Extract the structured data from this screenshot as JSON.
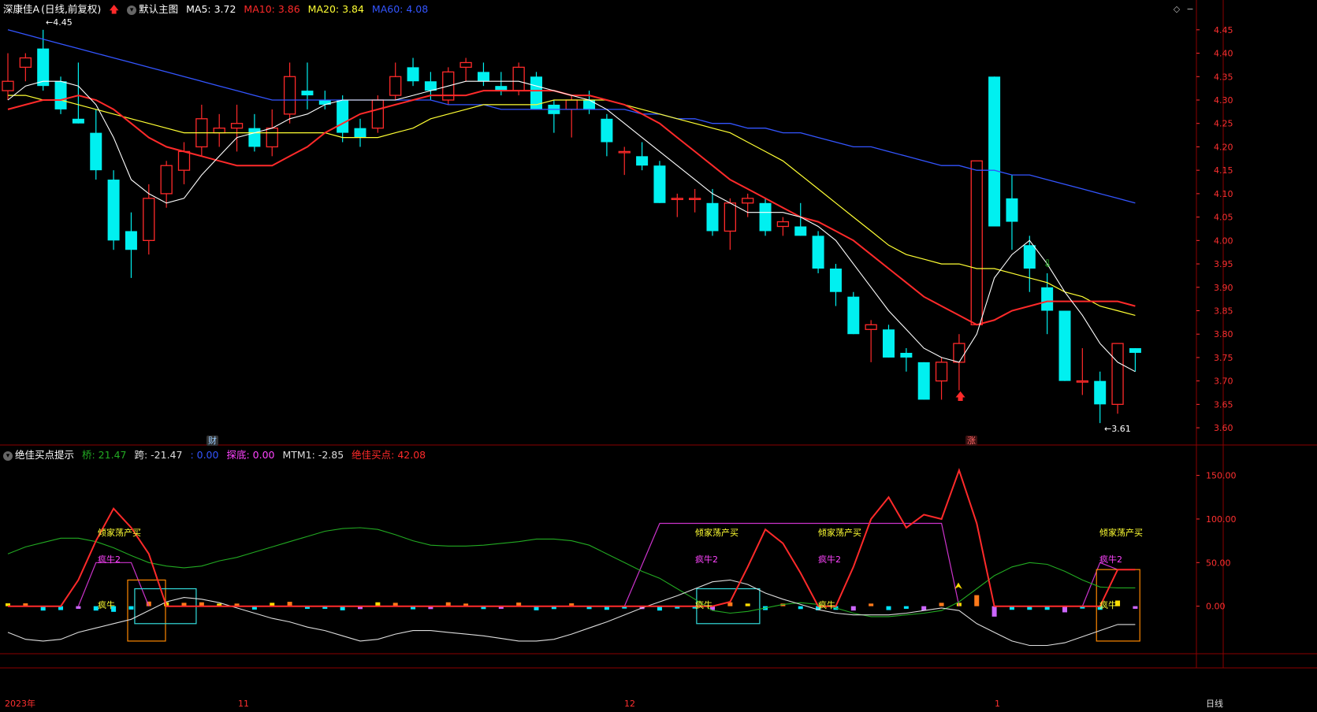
{
  "header": {
    "stock_name": "深康佳A",
    "period": "(日线,前复权)",
    "main_chart_label": "默认主图",
    "ma": [
      {
        "label": "MA5: 3.72",
        "color": "#ffffff"
      },
      {
        "label": "MA10: 3.86",
        "color": "#ff2a2a"
      },
      {
        "label": "MA20: 3.84",
        "color": "#ffff33"
      },
      {
        "label": "MA60: 4.08",
        "color": "#3355ff"
      }
    ],
    "icon_up_arrow": "red-up-arrow-icon",
    "icon_dropdown": "circle-dropdown-icon",
    "ctrl_diamond": "◇",
    "ctrl_minus": "−"
  },
  "indicator_header": {
    "name": "绝佳买点提示",
    "items": [
      {
        "label": "桥: 21.47",
        "color": "#22aa22"
      },
      {
        "label": "跨: -21.47",
        "color": "#dddddd"
      },
      {
        "label": ": 0.00",
        "color": "#3355ff"
      },
      {
        "label": "探底: 0.00",
        "color": "#ff44ff"
      },
      {
        "label": "MTM1: -2.85",
        "color": "#dddddd"
      },
      {
        "label": "绝佳买点: 42.08",
        "color": "#ff2a2a"
      }
    ]
  },
  "annotations": {
    "high_label": "4.45",
    "low_label": "3.61",
    "cai_badge": "财",
    "zhang_badge": "涨",
    "qingjia": "倾家荡产买",
    "fengniu2": "疯牛2",
    "fengniu": "疯牛"
  },
  "x_axis": {
    "labels": [
      "2023年",
      "11",
      "12",
      "1"
    ],
    "right_label": "日线"
  },
  "colors": {
    "up": "#ff2a2a",
    "down": "#00f0f0",
    "ma5": "#ffffff",
    "ma10": "#ff2a2a",
    "ma20": "#ffff33",
    "ma60": "#3355ff",
    "grid": "#8b0000",
    "axis_text": "#ff3030"
  },
  "chart_data": [
    {
      "type": "candlestick",
      "title": "深康佳A (日线,前复权)",
      "y_ticks": [
        4.45,
        4.4,
        4.35,
        4.3,
        4.25,
        4.2,
        4.15,
        4.1,
        4.05,
        4.0,
        3.95,
        3.9,
        3.85,
        3.8,
        3.75,
        3.7,
        3.65,
        3.6
      ],
      "ylim": [
        3.58,
        4.48
      ],
      "candles": [
        {
          "o": 4.32,
          "h": 4.4,
          "l": 4.3,
          "c": 4.34
        },
        {
          "o": 4.37,
          "h": 4.4,
          "l": 4.34,
          "c": 4.39
        },
        {
          "o": 4.41,
          "h": 4.45,
          "l": 4.32,
          "c": 4.33
        },
        {
          "o": 4.34,
          "h": 4.35,
          "l": 4.27,
          "c": 4.28
        },
        {
          "o": 4.26,
          "h": 4.38,
          "l": 4.25,
          "c": 4.25
        },
        {
          "o": 4.23,
          "h": 4.28,
          "l": 4.13,
          "c": 4.15
        },
        {
          "o": 4.13,
          "h": 4.15,
          "l": 3.98,
          "c": 4.0
        },
        {
          "o": 4.02,
          "h": 4.06,
          "l": 3.92,
          "c": 3.98
        },
        {
          "o": 4.0,
          "h": 4.12,
          "l": 3.97,
          "c": 4.09
        },
        {
          "o": 4.1,
          "h": 4.17,
          "l": 4.07,
          "c": 4.16
        },
        {
          "o": 4.15,
          "h": 4.21,
          "l": 4.12,
          "c": 4.19
        },
        {
          "o": 4.2,
          "h": 4.29,
          "l": 4.18,
          "c": 4.26
        },
        {
          "o": 4.23,
          "h": 4.27,
          "l": 4.2,
          "c": 4.24
        },
        {
          "o": 4.24,
          "h": 4.29,
          "l": 4.19,
          "c": 4.25
        },
        {
          "o": 4.24,
          "h": 4.27,
          "l": 4.19,
          "c": 4.2
        },
        {
          "o": 4.2,
          "h": 4.28,
          "l": 4.18,
          "c": 4.24
        },
        {
          "o": 4.27,
          "h": 4.38,
          "l": 4.25,
          "c": 4.35
        },
        {
          "o": 4.32,
          "h": 4.38,
          "l": 4.28,
          "c": 4.31
        },
        {
          "o": 4.3,
          "h": 4.32,
          "l": 4.28,
          "c": 4.29
        },
        {
          "o": 4.3,
          "h": 4.31,
          "l": 4.21,
          "c": 4.23
        },
        {
          "o": 4.24,
          "h": 4.26,
          "l": 4.2,
          "c": 4.22
        },
        {
          "o": 4.24,
          "h": 4.31,
          "l": 4.23,
          "c": 4.3
        },
        {
          "o": 4.31,
          "h": 4.38,
          "l": 4.3,
          "c": 4.35
        },
        {
          "o": 4.37,
          "h": 4.39,
          "l": 4.33,
          "c": 4.34
        },
        {
          "o": 4.34,
          "h": 4.36,
          "l": 4.3,
          "c": 4.32
        },
        {
          "o": 4.3,
          "h": 4.37,
          "l": 4.29,
          "c": 4.36
        },
        {
          "o": 4.37,
          "h": 4.39,
          "l": 4.34,
          "c": 4.38
        },
        {
          "o": 4.36,
          "h": 4.38,
          "l": 4.33,
          "c": 4.34
        },
        {
          "o": 4.33,
          "h": 4.36,
          "l": 4.31,
          "c": 4.32
        },
        {
          "o": 4.32,
          "h": 4.38,
          "l": 4.31,
          "c": 4.37
        },
        {
          "o": 4.35,
          "h": 4.36,
          "l": 4.28,
          "c": 4.28
        },
        {
          "o": 4.29,
          "h": 4.3,
          "l": 4.23,
          "c": 4.27
        },
        {
          "o": 4.28,
          "h": 4.31,
          "l": 4.22,
          "c": 4.3
        },
        {
          "o": 4.3,
          "h": 4.32,
          "l": 4.27,
          "c": 4.28
        },
        {
          "o": 4.26,
          "h": 4.27,
          "l": 4.18,
          "c": 4.21
        },
        {
          "o": 4.19,
          "h": 4.2,
          "l": 4.14,
          "c": 4.19
        },
        {
          "o": 4.18,
          "h": 4.21,
          "l": 4.15,
          "c": 4.16
        },
        {
          "o": 4.16,
          "h": 4.17,
          "l": 4.08,
          "c": 4.08
        },
        {
          "o": 4.09,
          "h": 4.1,
          "l": 4.05,
          "c": 4.09
        },
        {
          "o": 4.09,
          "h": 4.11,
          "l": 4.06,
          "c": 4.09
        },
        {
          "o": 4.08,
          "h": 4.11,
          "l": 4.01,
          "c": 4.02
        },
        {
          "o": 4.02,
          "h": 4.09,
          "l": 3.98,
          "c": 4.08
        },
        {
          "o": 4.08,
          "h": 4.1,
          "l": 4.05,
          "c": 4.09
        },
        {
          "o": 4.08,
          "h": 4.09,
          "l": 4.01,
          "c": 4.02
        },
        {
          "o": 4.03,
          "h": 4.05,
          "l": 4.01,
          "c": 4.04
        },
        {
          "o": 4.03,
          "h": 4.08,
          "l": 4.01,
          "c": 4.01
        },
        {
          "o": 4.01,
          "h": 4.02,
          "l": 3.93,
          "c": 3.94
        },
        {
          "o": 3.94,
          "h": 3.95,
          "l": 3.86,
          "c": 3.89
        },
        {
          "o": 3.88,
          "h": 3.89,
          "l": 3.8,
          "c": 3.8
        },
        {
          "o": 3.81,
          "h": 3.83,
          "l": 3.74,
          "c": 3.82
        },
        {
          "o": 3.81,
          "h": 3.82,
          "l": 3.75,
          "c": 3.75
        },
        {
          "o": 3.76,
          "h": 3.77,
          "l": 3.72,
          "c": 3.75
        },
        {
          "o": 3.74,
          "h": 3.74,
          "l": 3.66,
          "c": 3.66
        },
        {
          "o": 3.7,
          "h": 3.75,
          "l": 3.66,
          "c": 3.74
        },
        {
          "o": 3.74,
          "h": 3.8,
          "l": 3.68,
          "c": 3.78
        },
        {
          "o": 3.82,
          "h": 4.17,
          "l": 3.82,
          "c": 4.17
        },
        {
          "o": 4.35,
          "h": 4.35,
          "l": 4.03,
          "c": 4.03
        },
        {
          "o": 4.09,
          "h": 4.14,
          "l": 3.98,
          "c": 4.04
        },
        {
          "o": 3.99,
          "h": 4.01,
          "l": 3.89,
          "c": 3.94
        },
        {
          "o": 3.9,
          "h": 3.93,
          "l": 3.8,
          "c": 3.85
        },
        {
          "o": 3.85,
          "h": 3.85,
          "l": 3.7,
          "c": 3.7
        },
        {
          "o": 3.7,
          "h": 3.77,
          "l": 3.67,
          "c": 3.7
        },
        {
          "o": 3.7,
          "h": 3.72,
          "l": 3.61,
          "c": 3.65
        },
        {
          "o": 3.65,
          "h": 3.78,
          "l": 3.63,
          "c": 3.78
        },
        {
          "o": 3.77,
          "h": 3.77,
          "l": 3.72,
          "c": 3.76
        }
      ],
      "ma5": [
        4.3,
        4.33,
        4.34,
        4.34,
        4.33,
        4.29,
        4.22,
        4.13,
        4.1,
        4.08,
        4.09,
        4.14,
        4.18,
        4.22,
        4.23,
        4.24,
        4.26,
        4.27,
        4.29,
        4.3,
        4.3,
        4.3,
        4.3,
        4.31,
        4.32,
        4.33,
        4.34,
        4.34,
        4.34,
        4.34,
        4.33,
        4.32,
        4.31,
        4.3,
        4.28,
        4.25,
        4.22,
        4.19,
        4.16,
        4.13,
        4.1,
        4.08,
        4.06,
        4.06,
        4.06,
        4.05,
        4.03,
        4.0,
        3.95,
        3.9,
        3.85,
        3.81,
        3.77,
        3.75,
        3.74,
        3.8,
        3.92,
        3.97,
        4.0,
        3.95,
        3.89,
        3.84,
        3.78,
        3.74,
        3.72
      ],
      "ma10": [
        4.28,
        4.29,
        4.3,
        4.3,
        4.31,
        4.3,
        4.28,
        4.25,
        4.22,
        4.2,
        4.19,
        4.18,
        4.17,
        4.16,
        4.16,
        4.16,
        4.18,
        4.2,
        4.23,
        4.25,
        4.27,
        4.28,
        4.29,
        4.3,
        4.31,
        4.31,
        4.31,
        4.32,
        4.32,
        4.32,
        4.32,
        4.32,
        4.31,
        4.31,
        4.3,
        4.29,
        4.27,
        4.25,
        4.22,
        4.19,
        4.16,
        4.13,
        4.11,
        4.09,
        4.07,
        4.05,
        4.04,
        4.02,
        4.0,
        3.97,
        3.94,
        3.91,
        3.88,
        3.86,
        3.84,
        3.82,
        3.83,
        3.85,
        3.86,
        3.87,
        3.87,
        3.87,
        3.87,
        3.87,
        3.86
      ],
      "ma20": [
        4.31,
        4.31,
        4.3,
        4.3,
        4.29,
        4.28,
        4.27,
        4.26,
        4.25,
        4.24,
        4.23,
        4.23,
        4.23,
        4.23,
        4.23,
        4.23,
        4.23,
        4.23,
        4.23,
        4.22,
        4.22,
        4.22,
        4.23,
        4.24,
        4.26,
        4.27,
        4.28,
        4.29,
        4.29,
        4.29,
        4.29,
        4.3,
        4.3,
        4.3,
        4.3,
        4.29,
        4.28,
        4.27,
        4.26,
        4.25,
        4.24,
        4.23,
        4.21,
        4.19,
        4.17,
        4.14,
        4.11,
        4.08,
        4.05,
        4.02,
        3.99,
        3.97,
        3.96,
        3.95,
        3.95,
        3.94,
        3.94,
        3.93,
        3.92,
        3.91,
        3.89,
        3.88,
        3.86,
        3.85,
        3.84
      ],
      "ma60": [
        4.45,
        4.44,
        4.43,
        4.42,
        4.41,
        4.4,
        4.39,
        4.38,
        4.37,
        4.36,
        4.35,
        4.34,
        4.33,
        4.32,
        4.31,
        4.3,
        4.3,
        4.3,
        4.3,
        4.3,
        4.3,
        4.3,
        4.3,
        4.3,
        4.3,
        4.29,
        4.29,
        4.29,
        4.28,
        4.28,
        4.28,
        4.28,
        4.28,
        4.28,
        4.28,
        4.28,
        4.27,
        4.27,
        4.26,
        4.26,
        4.25,
        4.25,
        4.24,
        4.24,
        4.23,
        4.23,
        4.22,
        4.21,
        4.2,
        4.2,
        4.19,
        4.18,
        4.17,
        4.16,
        4.16,
        4.15,
        4.15,
        4.14,
        4.14,
        4.13,
        4.12,
        4.11,
        4.1,
        4.09,
        4.08
      ]
    },
    {
      "type": "indicator",
      "title": "绝佳买点提示",
      "y_ticks": [
        150.0,
        100.0,
        50.0,
        0.0
      ],
      "ylim": [
        -50,
        165
      ],
      "series": [
        {
          "name": "桥",
          "color": "#22aa22",
          "values": [
            60,
            68,
            73,
            78,
            78,
            74,
            67,
            58,
            50,
            46,
            44,
            46,
            52,
            56,
            62,
            68,
            74,
            80,
            86,
            89,
            90,
            88,
            82,
            75,
            70,
            69,
            69,
            70,
            72,
            74,
            77,
            77,
            75,
            70,
            60,
            50,
            40,
            32,
            20,
            8,
            -5,
            -8,
            -6,
            -2,
            2,
            4,
            2,
            -2,
            -8,
            -12,
            -12,
            -10,
            -8,
            -5,
            5,
            20,
            35,
            45,
            50,
            48,
            40,
            30,
            22,
            21,
            21
          ]
        },
        {
          "name": "跨",
          "color": "#dddddd",
          "values": [
            -30,
            -38,
            -40,
            -38,
            -30,
            -25,
            -20,
            -15,
            -5,
            5,
            10,
            8,
            4,
            -2,
            -8,
            -14,
            -18,
            -24,
            -28,
            -34,
            -40,
            -38,
            -32,
            -28,
            -28,
            -30,
            -32,
            -34,
            -37,
            -40,
            -40,
            -38,
            -32,
            -25,
            -18,
            -10,
            -2,
            5,
            12,
            20,
            28,
            30,
            25,
            15,
            8,
            2,
            -4,
            -8,
            -10,
            -10,
            -10,
            -8,
            -5,
            -2,
            -5,
            -20,
            -30,
            -40,
            -45,
            -45,
            -42,
            -35,
            -28,
            -21,
            -21
          ]
        },
        {
          "name": "绝佳买点",
          "color": "#ff2a2a",
          "values": [
            0,
            0,
            0,
            0,
            30,
            75,
            112,
            90,
            60,
            0,
            0,
            0,
            0,
            0,
            0,
            0,
            0,
            0,
            0,
            0,
            0,
            0,
            0,
            0,
            0,
            0,
            0,
            0,
            0,
            0,
            0,
            0,
            0,
            0,
            0,
            0,
            0,
            0,
            0,
            0,
            0,
            5,
            45,
            88,
            72,
            38,
            0,
            0,
            45,
            100,
            125,
            90,
            105,
            100,
            156,
            95,
            0,
            0,
            0,
            0,
            0,
            0,
            0,
            42,
            42
          ]
        }
      ]
    }
  ]
}
